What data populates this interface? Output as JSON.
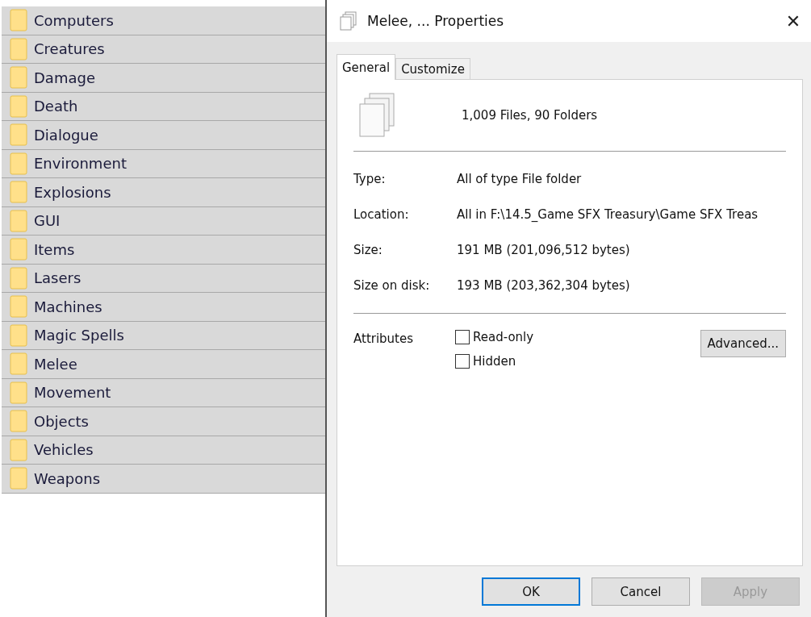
{
  "folders": [
    {
      "name": "Computers",
      "selected": true
    },
    {
      "name": "Creatures",
      "selected": true
    },
    {
      "name": "Damage",
      "selected": true
    },
    {
      "name": "Death",
      "selected": true
    },
    {
      "name": "Dialogue",
      "selected": true
    },
    {
      "name": "Environment",
      "selected": true
    },
    {
      "name": "Explosions",
      "selected": true
    },
    {
      "name": "GUI",
      "selected": true
    },
    {
      "name": "Items",
      "selected": true
    },
    {
      "name": "Lasers",
      "selected": true
    },
    {
      "name": "Machines",
      "selected": true
    },
    {
      "name": "Magic Spells",
      "selected": true
    },
    {
      "name": "Melee",
      "selected": true
    },
    {
      "name": "Movement",
      "selected": true
    },
    {
      "name": "Objects",
      "selected": true
    },
    {
      "name": "Vehicles",
      "selected": true
    },
    {
      "name": "Weapons",
      "selected": true
    }
  ],
  "window": {
    "title": "Melee, ... Properties",
    "close": "✕"
  },
  "tabs": [
    {
      "label": "General",
      "selected": true
    },
    {
      "label": "Customize",
      "selected": false
    }
  ],
  "summary": "1,009 Files, 90 Folders",
  "properties": [
    {
      "label": "Type:",
      "value": "All of type File folder"
    },
    {
      "label": "Location:",
      "value": "All in F:\\14.5_Game SFX Treasury\\Game SFX Treas"
    },
    {
      "label": "Size:",
      "value": "191 MB (201,096,512 bytes)"
    },
    {
      "label": "Size on disk:",
      "value": "193 MB (203,362,304 bytes)"
    }
  ],
  "attributes": {
    "label": "Attributes",
    "checkboxes": [
      {
        "label": "Read-only",
        "checked": false
      },
      {
        "label": "Hidden",
        "checked": false
      }
    ],
    "advanced": "Advanced..."
  },
  "buttons": [
    {
      "label": "OK",
      "kind": "default",
      "disabled": false
    },
    {
      "label": "Cancel",
      "kind": "normal",
      "disabled": false
    },
    {
      "label": "Apply",
      "kind": "normal",
      "disabled": true
    }
  ]
}
